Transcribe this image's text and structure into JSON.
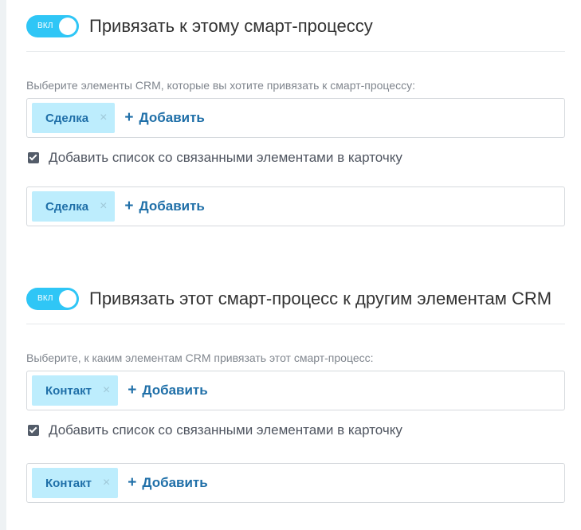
{
  "section1": {
    "toggle_label": "ВКЛ",
    "title": "Привязать к этому смарт-процессу",
    "field_label": "Выберите элементы CRM, которые вы хотите привязать к смарт-процессу:",
    "tag": "Сделка",
    "remove_glyph": "×",
    "add_plus": "+",
    "add_label": "Добавить",
    "checkbox_label": "Добавить список со связанными элементами в карточку",
    "card_tag": "Сделка"
  },
  "section2": {
    "toggle_label": "ВКЛ",
    "title": "Привязать этот смарт-процесс к другим элементам CRM",
    "field_label": "Выберите, к каким элементам CRM привязать этот смарт-процесс:",
    "tag": "Контакт",
    "remove_glyph": "×",
    "add_plus": "+",
    "add_label": "Добавить",
    "checkbox_label": "Добавить список со связанными элементами в карточку",
    "card_tag": "Контакт"
  },
  "colors": {
    "toggle_on": "#2fc6f6",
    "tag_bg": "#bdedfd",
    "link": "#1f6fa8"
  },
  "icons": [
    "toggle-switch",
    "close-icon",
    "plus-icon",
    "checkbox-checked"
  ]
}
